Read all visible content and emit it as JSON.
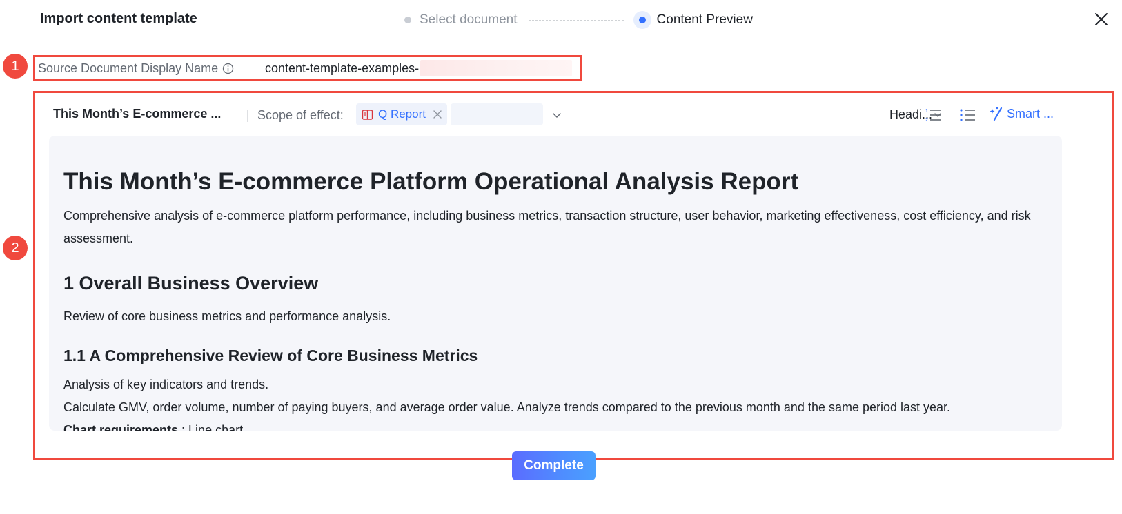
{
  "modal": {
    "title": "Import content template",
    "steps": [
      {
        "label": "Select document",
        "state": "inactive"
      },
      {
        "label": "Content Preview",
        "state": "active"
      }
    ],
    "close_icon": "close-icon"
  },
  "markers": [
    "1",
    "2"
  ],
  "source": {
    "label": "Source Document Display Name",
    "info_icon": "info-icon",
    "value": "content-template-examples-"
  },
  "toolbar": {
    "doc_name": "This Month’s E-commerce ...",
    "scope_label": "Scope of effect:",
    "scope_tag": "Q Report",
    "heading_select": "Headi...",
    "smart_label": "Smart ..."
  },
  "document": {
    "title": "This Month’s E-commerce Platform Operational Analysis Report",
    "intro": "Comprehensive analysis of e-commerce platform performance, including business metrics, transaction structure, user behavior, marketing effectiveness, cost efficiency, and risk assessment.",
    "section1_heading": "1 Overall Business Overview",
    "section1_text": "Review of core business metrics and performance analysis.",
    "section11_heading": "1.1 A Comprehensive Review of Core Business Metrics",
    "section11_line1": "Analysis of key indicators and trends.",
    "section11_line2": "Calculate GMV, order volume, number of paying buyers, and average order value. Analyze trends compared to the previous month and the same period last year.",
    "req_label": "Chart requirements",
    "req_value": " : Line chart"
  },
  "footer": {
    "complete_label": "Complete"
  },
  "colors": {
    "accent": "#3370ff",
    "highlight": "#f0493e",
    "doc_bg": "#f5f6fa"
  }
}
